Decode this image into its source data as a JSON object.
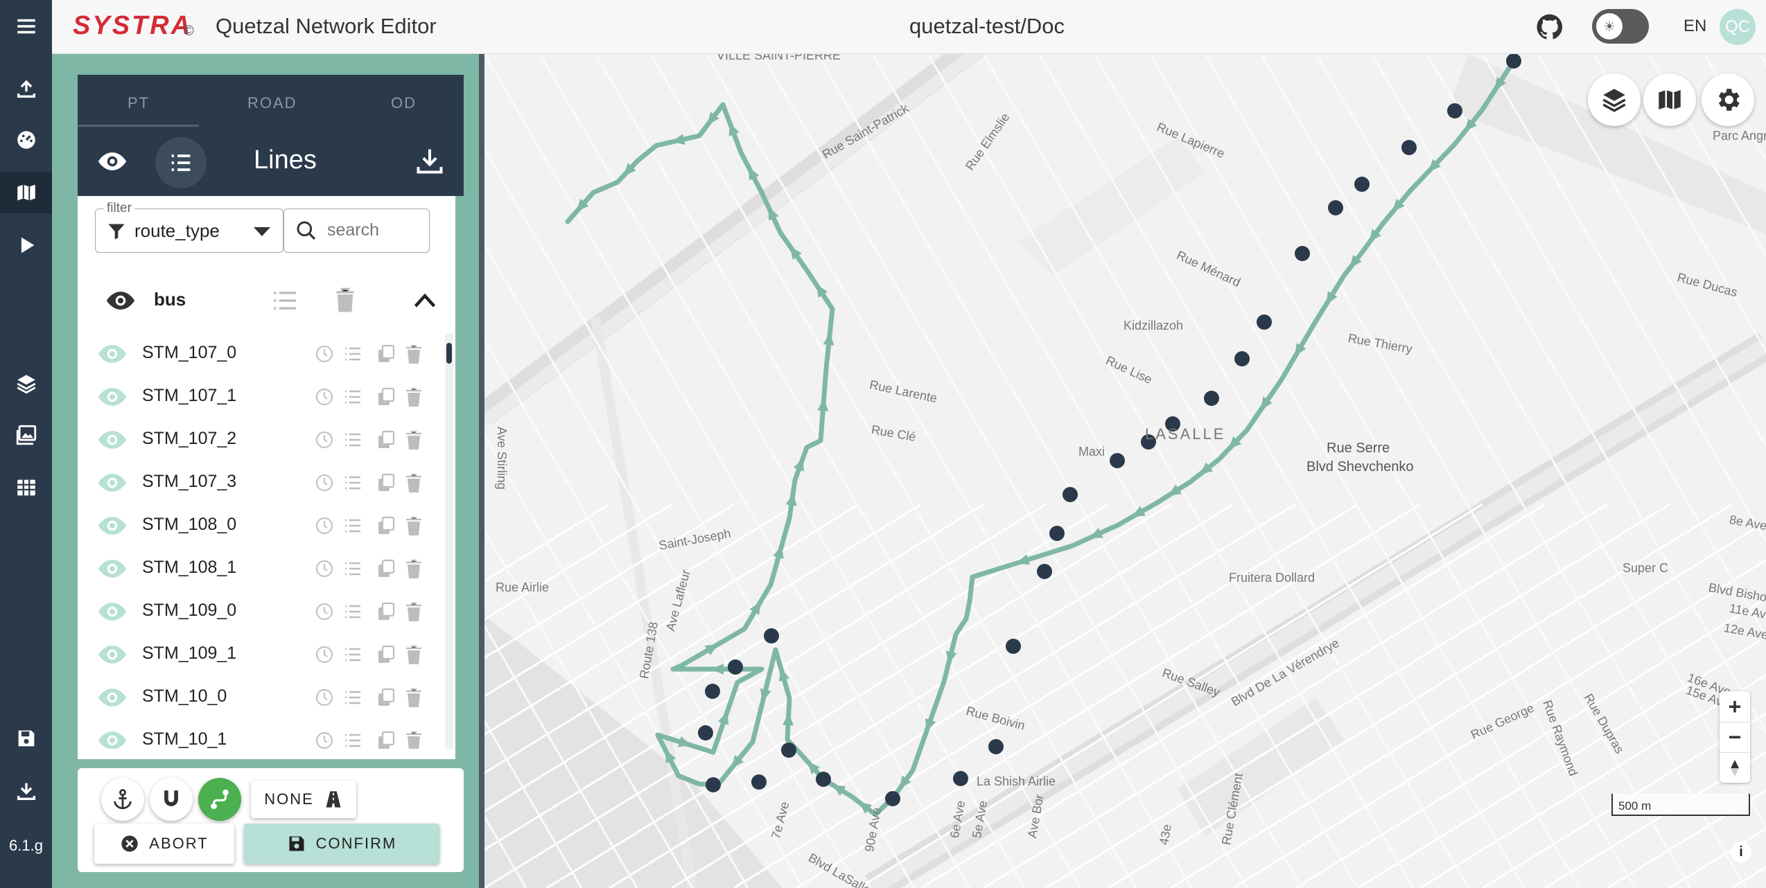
{
  "header": {
    "brand": "SYSTRA",
    "brand_mark": "©",
    "app_title": "Quetzal Network Editor",
    "project_title": "quetzal-test/Doc",
    "language": "EN",
    "avatar_initials": "QC"
  },
  "rail": {
    "version": "6.1.g",
    "icons": [
      "menu-icon",
      "upload-icon",
      "dashboard-icon",
      "map-icon",
      "play-icon",
      "layers-icon",
      "images-icon",
      "table-icon",
      "save-icon",
      "download-icon"
    ]
  },
  "panel": {
    "tabs": [
      "PT",
      "ROAD",
      "OD"
    ],
    "title": "Lines",
    "filter": {
      "legend": "filter",
      "value": "route_type"
    },
    "search": {
      "placeholder": "search"
    },
    "group": {
      "name": "bus"
    },
    "lines": [
      "STM_107_0",
      "STM_107_1",
      "STM_107_2",
      "STM_107_3",
      "STM_108_0",
      "STM_108_1",
      "STM_109_0",
      "STM_109_1",
      "STM_10_0",
      "STM_10_1"
    ]
  },
  "bottom": {
    "none_label": "NONE",
    "abort_label": "ABORT",
    "confirm_label": "CONFIRM"
  },
  "map": {
    "streets": [
      "VILLE SAINT-PIERRE",
      "Rue Lapierre",
      "Rue Saint-Patrick",
      "Rue Elmslie",
      "Rue Ménard",
      "Rue Ducas",
      "Kidzillazoh",
      "Rue Thierry",
      "Rue Lise",
      "Rue Larente",
      "Rue Clé",
      "Ave Stirling",
      "Rue Serre",
      "Blvd Shevchenko",
      "Fruitera Dollard",
      "Rue Airlie",
      "Route 138",
      "Ave Lafleur",
      "Rue Salley",
      "Rue Boivin",
      "Blvd De La Vérendrye",
      "Rue George",
      "La Shish Airlie",
      "Blvd LaSalle",
      "Super C",
      "Blvd Bishop",
      "Parc Angrignon",
      "LASALLE",
      "Maxi",
      "8e Ave",
      "11e Ave",
      "12e Ave",
      "16e Ave",
      "15e Ave",
      "Rue Raymond",
      "Rue Dupras",
      "7e Ave",
      "5e Ave",
      "6e Ave",
      "Ave Bor",
      "43e",
      "Rue Clément",
      "Saint-Joseph",
      "90e Ave"
    ],
    "scale_label": "500 m",
    "zoom_in": "+",
    "zoom_out": "−",
    "info": "i",
    "line_color": "#7fb7a6",
    "stop_color": "#2b3a4a"
  }
}
